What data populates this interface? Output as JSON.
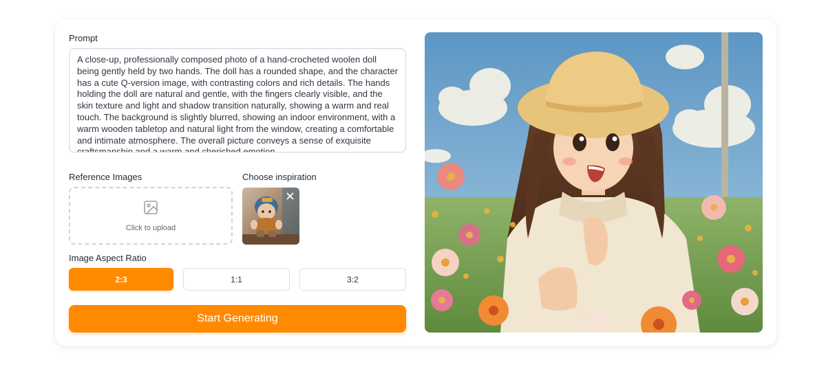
{
  "prompt": {
    "label": "Prompt",
    "text": "A close-up, professionally composed photo of a hand-crocheted woolen doll being gently held by two hands. The doll has a rounded shape, and the character has a cute Q-version image, with contrasting colors and rich details. The hands holding the doll are natural and gentle, with the fingers clearly visible, and the skin texture and light and shadow transition naturally, showing a warm and real touch. The background is slightly blurred, showing an indoor environment, with a warm wooden tabletop and natural light from the window, creating a comfortable and intimate atmosphere. The overall picture conveys a sense of exquisite craftsmanship and a warm and cherished emotion."
  },
  "reference": {
    "label": "Reference Images",
    "upload_text": "Click to upload",
    "icon": "image-icon"
  },
  "inspiration": {
    "label": "Choose inspiration",
    "close_icon": "close-icon"
  },
  "aspect_ratio": {
    "label": "Image Aspect Ratio",
    "options": [
      "2:3",
      "1:1",
      "3:2"
    ],
    "selected": "2:3"
  },
  "start_button": "Start Generating",
  "colors": {
    "accent": "#ff8a00",
    "border": "#dde1e6"
  }
}
